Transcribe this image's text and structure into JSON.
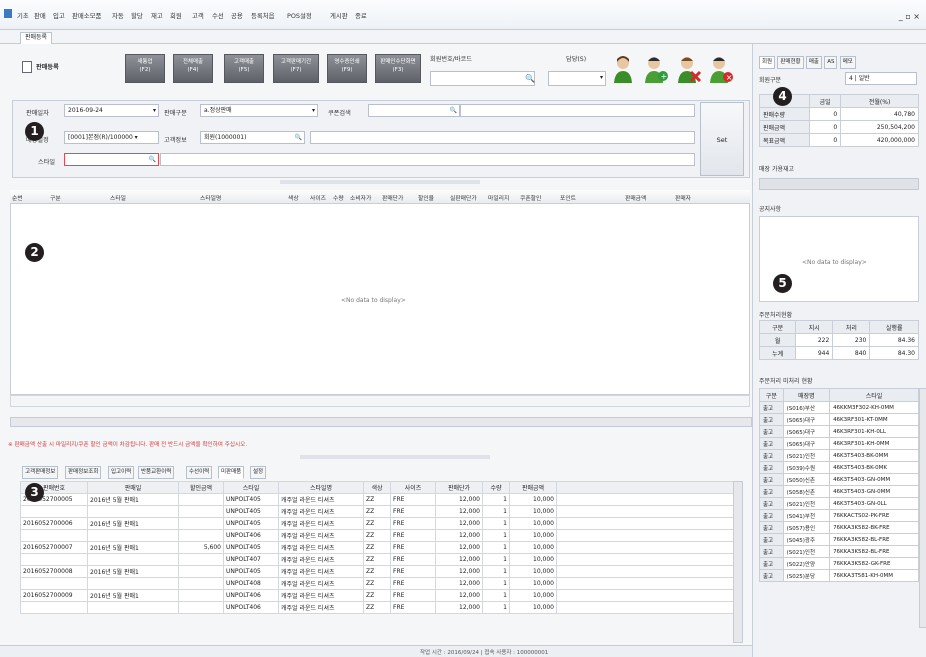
{
  "menu": [
    "기초",
    "판매",
    "입고",
    "판매소모품",
    "자동",
    "할당",
    "재고",
    "회원",
    "고객",
    "수선",
    "공용",
    "등록처읍",
    "POS설정",
    "게시판",
    "종료"
  ],
  "window_controls": "_ ▫ ×",
  "doc_tab": "판매등록",
  "page_title": "판매등록",
  "toolbar": [
    {
      "line1": "새통업",
      "line2": "(F2)"
    },
    {
      "line1": "전체매출",
      "line2": "(F4)"
    },
    {
      "line1": "고객매출",
      "line2": "(F5)"
    },
    {
      "line1": "고객판매기간",
      "line2": "(F7)"
    },
    {
      "line1": "영수증인쇄",
      "line2": "(F9)"
    },
    {
      "line1": "판매인수단화면",
      "line2": "(F3)"
    }
  ],
  "top_search_label": "회원번호/바코드",
  "staff_label": "담당(S)",
  "form": {
    "date_label": "판매일자",
    "date_value": "2016-09-24",
    "sale_type_label": "판매구분",
    "sale_type_value": "a.정상판매",
    "coupon_label": "쿠폰검색",
    "store_label": "매장설정",
    "store_value": "[0001]본점(R)/100000 ▾",
    "customer_label": "고객정보",
    "customer_value": "회원(1000001)",
    "item_label": "스타일",
    "set_button": "Set"
  },
  "grid_headers": [
    "순번",
    "구분",
    "스타일",
    "스타일명",
    "색상",
    "사이즈",
    "수량",
    "소비자가",
    "판매단가",
    "할인율",
    "실판매단가",
    "마일리지",
    "쿠폰할인",
    "포인트",
    "판매금액",
    "판매자"
  ],
  "nodata": "<No data to display>",
  "warning": "※ 판매금액 산출 시 마일리지/쿠폰 할인 금액이 차감됩니다. 판매 전 반드시 금액을 확인하여 주십시오.",
  "bottom_tabs": [
    "고객판매정보",
    "판매정보조회",
    "입고이력",
    "반품교환이력",
    "수선이력",
    "미판매품",
    "설정"
  ],
  "bottom_headers": [
    "판매번호",
    "판매일",
    "할인금액",
    "스타일",
    "스타일명",
    "색상",
    "사이즈",
    "판매단가",
    "수량",
    "판매금액"
  ],
  "bottom_rows": [
    {
      "no": "2016052700005",
      "date": "2016년 5월 판매1",
      "disc": "",
      "style": "UNPOLT405",
      "name": "캐주얼 라운드 티셔츠",
      "color": "ZZ",
      "size": "FRE",
      "price": "12,000",
      "qty": "1",
      "amt": "10,000"
    },
    {
      "no": "",
      "date": "",
      "disc": "",
      "style": "UNPOLT405",
      "name": "캐주얼 라운드 티셔츠",
      "color": "ZZ",
      "size": "FRE",
      "price": "12,000",
      "qty": "1",
      "amt": "10,000"
    },
    {
      "no": "2016052700006",
      "date": "2016년 5월 판매1",
      "disc": "",
      "style": "UNPOLT405",
      "name": "캐주얼 라운드 티셔츠",
      "color": "ZZ",
      "size": "FRE",
      "price": "12,000",
      "qty": "1",
      "amt": "10,000"
    },
    {
      "no": "",
      "date": "",
      "disc": "",
      "style": "UNPOLT406",
      "name": "캐주얼 라운드 티셔츠",
      "color": "ZZ",
      "size": "FRE",
      "price": "12,000",
      "qty": "1",
      "amt": "10,000"
    },
    {
      "no": "2016052700007",
      "date": "2016년 5월 판매1",
      "disc": "5,600",
      "style": "UNPOLT405",
      "name": "캐주얼 라운드 티셔츠",
      "color": "ZZ",
      "size": "FRE",
      "price": "12,000",
      "qty": "1",
      "amt": "10,000"
    },
    {
      "no": "",
      "date": "",
      "disc": "",
      "style": "UNPOLT407",
      "name": "캐주얼 라운드 티셔츠",
      "color": "ZZ",
      "size": "FRE",
      "price": "12,000",
      "qty": "1",
      "amt": "10,000"
    },
    {
      "no": "2016052700008",
      "date": "2016년 5월 판매1",
      "disc": "",
      "style": "UNPOLT405",
      "name": "캐주얼 라운드 티셔츠",
      "color": "ZZ",
      "size": "FRE",
      "price": "12,000",
      "qty": "1",
      "amt": "10,000"
    },
    {
      "no": "",
      "date": "",
      "disc": "",
      "style": "UNPOLT408",
      "name": "캐주얼 라운드 티셔츠",
      "color": "ZZ",
      "size": "FRE",
      "price": "12,000",
      "qty": "1",
      "amt": "10,000"
    },
    {
      "no": "2016052700009",
      "date": "2016년 5월 판매1",
      "disc": "",
      "style": "UNPOLT406",
      "name": "캐주얼 라운드 티셔츠",
      "color": "ZZ",
      "size": "FRE",
      "price": "12,000",
      "qty": "1",
      "amt": "10,000"
    },
    {
      "no": "",
      "date": "",
      "disc": "",
      "style": "UNPOLT406",
      "name": "캐주얼 라운드 티셔츠",
      "color": "ZZ",
      "size": "FRE",
      "price": "12,000",
      "qty": "1",
      "amt": "10,000"
    }
  ],
  "right_tabs": [
    "회원",
    "판매현황",
    "매출",
    "AS",
    "메모"
  ],
  "right": {
    "member_label": "회원구분",
    "member_value": "4 | 일반",
    "stats_headers": [
      "",
      "금일",
      "전월(%)"
    ],
    "stats": [
      {
        "k": "판매수량",
        "a": "0",
        "b": "40,780"
      },
      {
        "k": "판매금액",
        "a": "0",
        "b": "250,504,200"
      },
      {
        "k": "목표금액",
        "a": "0",
        "b": "420,000,000"
      }
    ],
    "stock_label": "매장 가용재고",
    "notice_label": "공지사항",
    "notice_nodata": "<No data to display>",
    "rank_label": "주문처리현황",
    "rank_headers": [
      "구분",
      "지시",
      "처리",
      "실행률"
    ],
    "rank_rows": [
      {
        "k": "월",
        "a": "222",
        "b": "230",
        "c": "84.36"
      },
      {
        "k": "누계",
        "a": "944",
        "b": "840",
        "c": "84.30"
      }
    ],
    "list_label": "주문처리 미처리 현황",
    "list_headers": [
      "구분",
      "매장명",
      "스타일"
    ],
    "list_rows": [
      {
        "k": "출고",
        "s": "(S016)부산",
        "st": "46KKM3F302-KH-0MM"
      },
      {
        "k": "출고",
        "s": "(S065)대구",
        "st": "46K3RF301-KT-0MM"
      },
      {
        "k": "출고",
        "s": "(S065)대구",
        "st": "46K3RF301-KH-0LL"
      },
      {
        "k": "출고",
        "s": "(S065)대구",
        "st": "46K3RF301-KH-0MM"
      },
      {
        "k": "출고",
        "s": "(S021)인천",
        "st": "46K3T5403-BK-0MM"
      },
      {
        "k": "출고",
        "s": "(S039)수원",
        "st": "46K3T5403-BK-0MK"
      },
      {
        "k": "출고",
        "s": "(S050)신촌",
        "st": "46K3T5403-GN-0MM"
      },
      {
        "k": "출고",
        "s": "(S058)신촌",
        "st": "46K3T5403-GN-0MM"
      },
      {
        "k": "출고",
        "s": "(S021)인천",
        "st": "46K3T5403-GN-0LL"
      },
      {
        "k": "출고",
        "s": "(S041)부천",
        "st": "76KKACTS02-PK-FRE"
      },
      {
        "k": "출고",
        "s": "(S057)용인",
        "st": "76KKA3K582-BK-FRE"
      },
      {
        "k": "출고",
        "s": "(S045)광주",
        "st": "76KKA3K582-BL-FRE"
      },
      {
        "k": "출고",
        "s": "(S021)인천",
        "st": "76KKA3K582-BL-FRE"
      },
      {
        "k": "출고",
        "s": "(S022)안양",
        "st": "76KKA3K582-GK-FRE"
      },
      {
        "k": "출고",
        "s": "(S025)분당",
        "st": "76KKA3T581-KH-0MM"
      }
    ]
  },
  "markers": [
    "1",
    "2",
    "3",
    "4",
    "5"
  ],
  "status_text": "작업 시간 : 2016/09/24  |  접속 사용자 : 100000001"
}
